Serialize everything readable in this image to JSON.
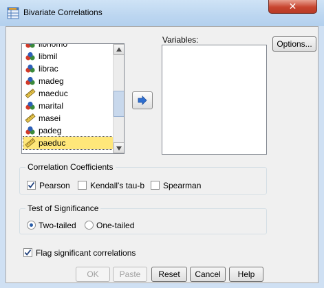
{
  "window": {
    "title": "Bivariate Correlations",
    "close_icon": "close-icon",
    "accent": "#c8452f"
  },
  "source_list": {
    "items": [
      {
        "label": "libhomo",
        "icon": "nominal-icon"
      },
      {
        "label": "libmil",
        "icon": "nominal-icon"
      },
      {
        "label": "librac",
        "icon": "nominal-icon"
      },
      {
        "label": "madeg",
        "icon": "nominal-icon"
      },
      {
        "label": "maeduc",
        "icon": "scale-icon"
      },
      {
        "label": "marital",
        "icon": "nominal-icon"
      },
      {
        "label": "masei",
        "icon": "scale-icon"
      },
      {
        "label": "padeg",
        "icon": "nominal-icon"
      },
      {
        "label": "paeduc",
        "icon": "scale-icon",
        "selected": true
      }
    ]
  },
  "move_button_icon": "arrow-right-icon",
  "variables": {
    "label": "Variables:",
    "items": []
  },
  "options_button": "Options...",
  "correlation_coefficients": {
    "legend": "Correlation Coefficients",
    "pearson": {
      "label": "Pearson",
      "checked": true
    },
    "kendall": {
      "label": "Kendall's tau-b",
      "checked": false
    },
    "spearman": {
      "label": "Spearman",
      "checked": false
    }
  },
  "test_of_significance": {
    "legend": "Test of Significance",
    "two_tailed": {
      "label": "Two-tailed",
      "selected": true
    },
    "one_tailed": {
      "label": "One-tailed",
      "selected": false
    }
  },
  "flag_significant": {
    "label": "Flag significant correlations",
    "checked": true
  },
  "buttons": {
    "ok": "OK",
    "paste": "Paste",
    "reset": "Reset",
    "cancel": "Cancel",
    "help": "Help"
  }
}
